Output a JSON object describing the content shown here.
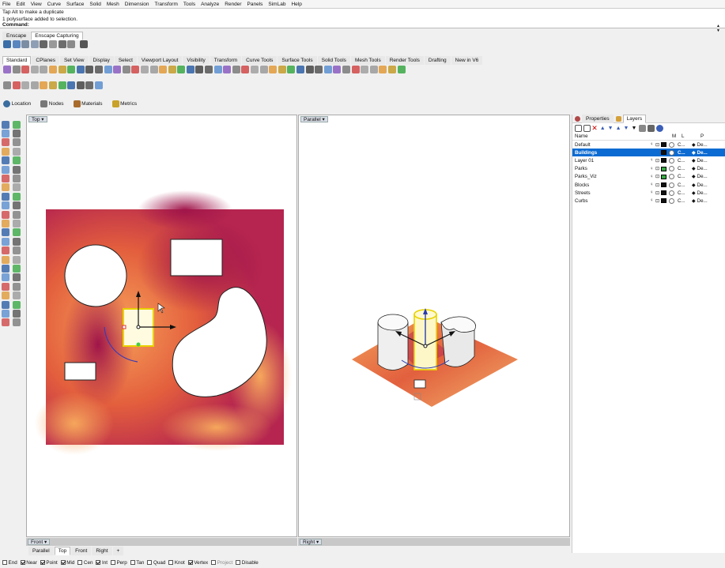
{
  "menu": [
    "File",
    "Edit",
    "View",
    "Curve",
    "Surface",
    "Solid",
    "Mesh",
    "Dimension",
    "Transform",
    "Tools",
    "Analyze",
    "Render",
    "Panels",
    "SimLab",
    "Help"
  ],
  "command_history": [
    "Tap Alt to make a duplicate",
    "1 polysurface added to selection."
  ],
  "command_prompt": "Command:",
  "plugin_tabs": [
    "Enscape",
    "Enscape Capturing"
  ],
  "toolbar_tabs": [
    "Standard",
    "CPlanes",
    "Set View",
    "Display",
    "Select",
    "Viewport Layout",
    "Visibility",
    "Transform",
    "Curve Tools",
    "Surface Tools",
    "Solid Tools",
    "Mesh Tools",
    "Render Tools",
    "Drafting",
    "New in V6"
  ],
  "panels_row": [
    "Location",
    "Nodes",
    "Materials",
    "Metrics"
  ],
  "viewports": {
    "top_label": "Top",
    "parallel_label": "Parallel",
    "front_label": "Front",
    "right_label": "Right"
  },
  "viewport_tabs": [
    "Parallel",
    "Top",
    "Front",
    "Right"
  ],
  "layer_panel": {
    "tabs": [
      "Properties",
      "Layers"
    ],
    "columns": [
      "Name",
      "M",
      "L",
      "P"
    ],
    "layers": [
      {
        "name": "Default",
        "color": "#111111",
        "material": "C...",
        "print": "De..."
      },
      {
        "name": "Buildings",
        "color": "#111111",
        "material": "C...",
        "print": "De...",
        "selected": true
      },
      {
        "name": "Layer 01",
        "color": "#111111",
        "material": "C...",
        "print": "De..."
      },
      {
        "name": "Parks",
        "color": "#3aa845",
        "material": "C...",
        "print": "De..."
      },
      {
        "name": "Parks_Viz",
        "color": "#3aa845",
        "material": "C...",
        "print": "De..."
      },
      {
        "name": "Blocks",
        "color": "#111111",
        "material": "C...",
        "print": "De..."
      },
      {
        "name": "Streets",
        "color": "#111111",
        "material": "C...",
        "print": "De..."
      },
      {
        "name": "Curbs",
        "color": "#111111",
        "material": "C...",
        "print": "De..."
      }
    ]
  },
  "osnaps": [
    {
      "label": "End",
      "on": false
    },
    {
      "label": "Near",
      "on": true
    },
    {
      "label": "Point",
      "on": true
    },
    {
      "label": "Mid",
      "on": true
    },
    {
      "label": "Cen",
      "on": false
    },
    {
      "label": "Int",
      "on": true
    },
    {
      "label": "Perp",
      "on": false
    },
    {
      "label": "Tan",
      "on": false
    },
    {
      "label": "Quad",
      "on": false
    },
    {
      "label": "Knot",
      "on": false
    },
    {
      "label": "Vertex",
      "on": true
    },
    {
      "label": "Project",
      "on": false
    },
    {
      "label": "Disable",
      "on": false
    }
  ]
}
